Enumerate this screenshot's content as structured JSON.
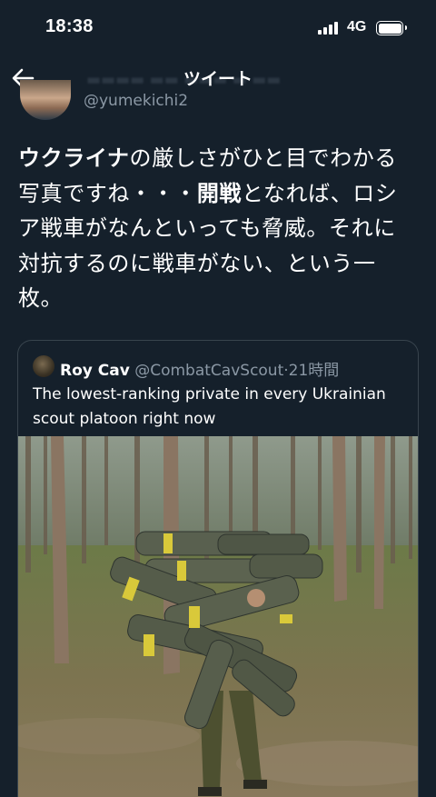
{
  "status_bar": {
    "time": "18:38",
    "network": "4G"
  },
  "header": {
    "title": "ツイート",
    "back_icon": "arrow-left-icon"
  },
  "author": {
    "handle": "@yumekichi2"
  },
  "tweet": {
    "segments": [
      {
        "text": "ウクライナ",
        "bold": true
      },
      {
        "text": "の厳しさがひと目でわかる写真ですね・・・",
        "bold": false
      },
      {
        "text": "開戦",
        "bold": true
      },
      {
        "text": "となれば、ロシア戦車がなんといっても脅威。それに対抗するのに戦車がない、という一枚。",
        "bold": false
      }
    ]
  },
  "quoted_tweet": {
    "name": "Roy Cav",
    "handle": "@CombatCavScout",
    "separator": "·",
    "time": "21時間",
    "text": "The lowest-ranking private in every Ukrainian scout platoon right now",
    "media": {
      "type": "photo"
    }
  }
}
